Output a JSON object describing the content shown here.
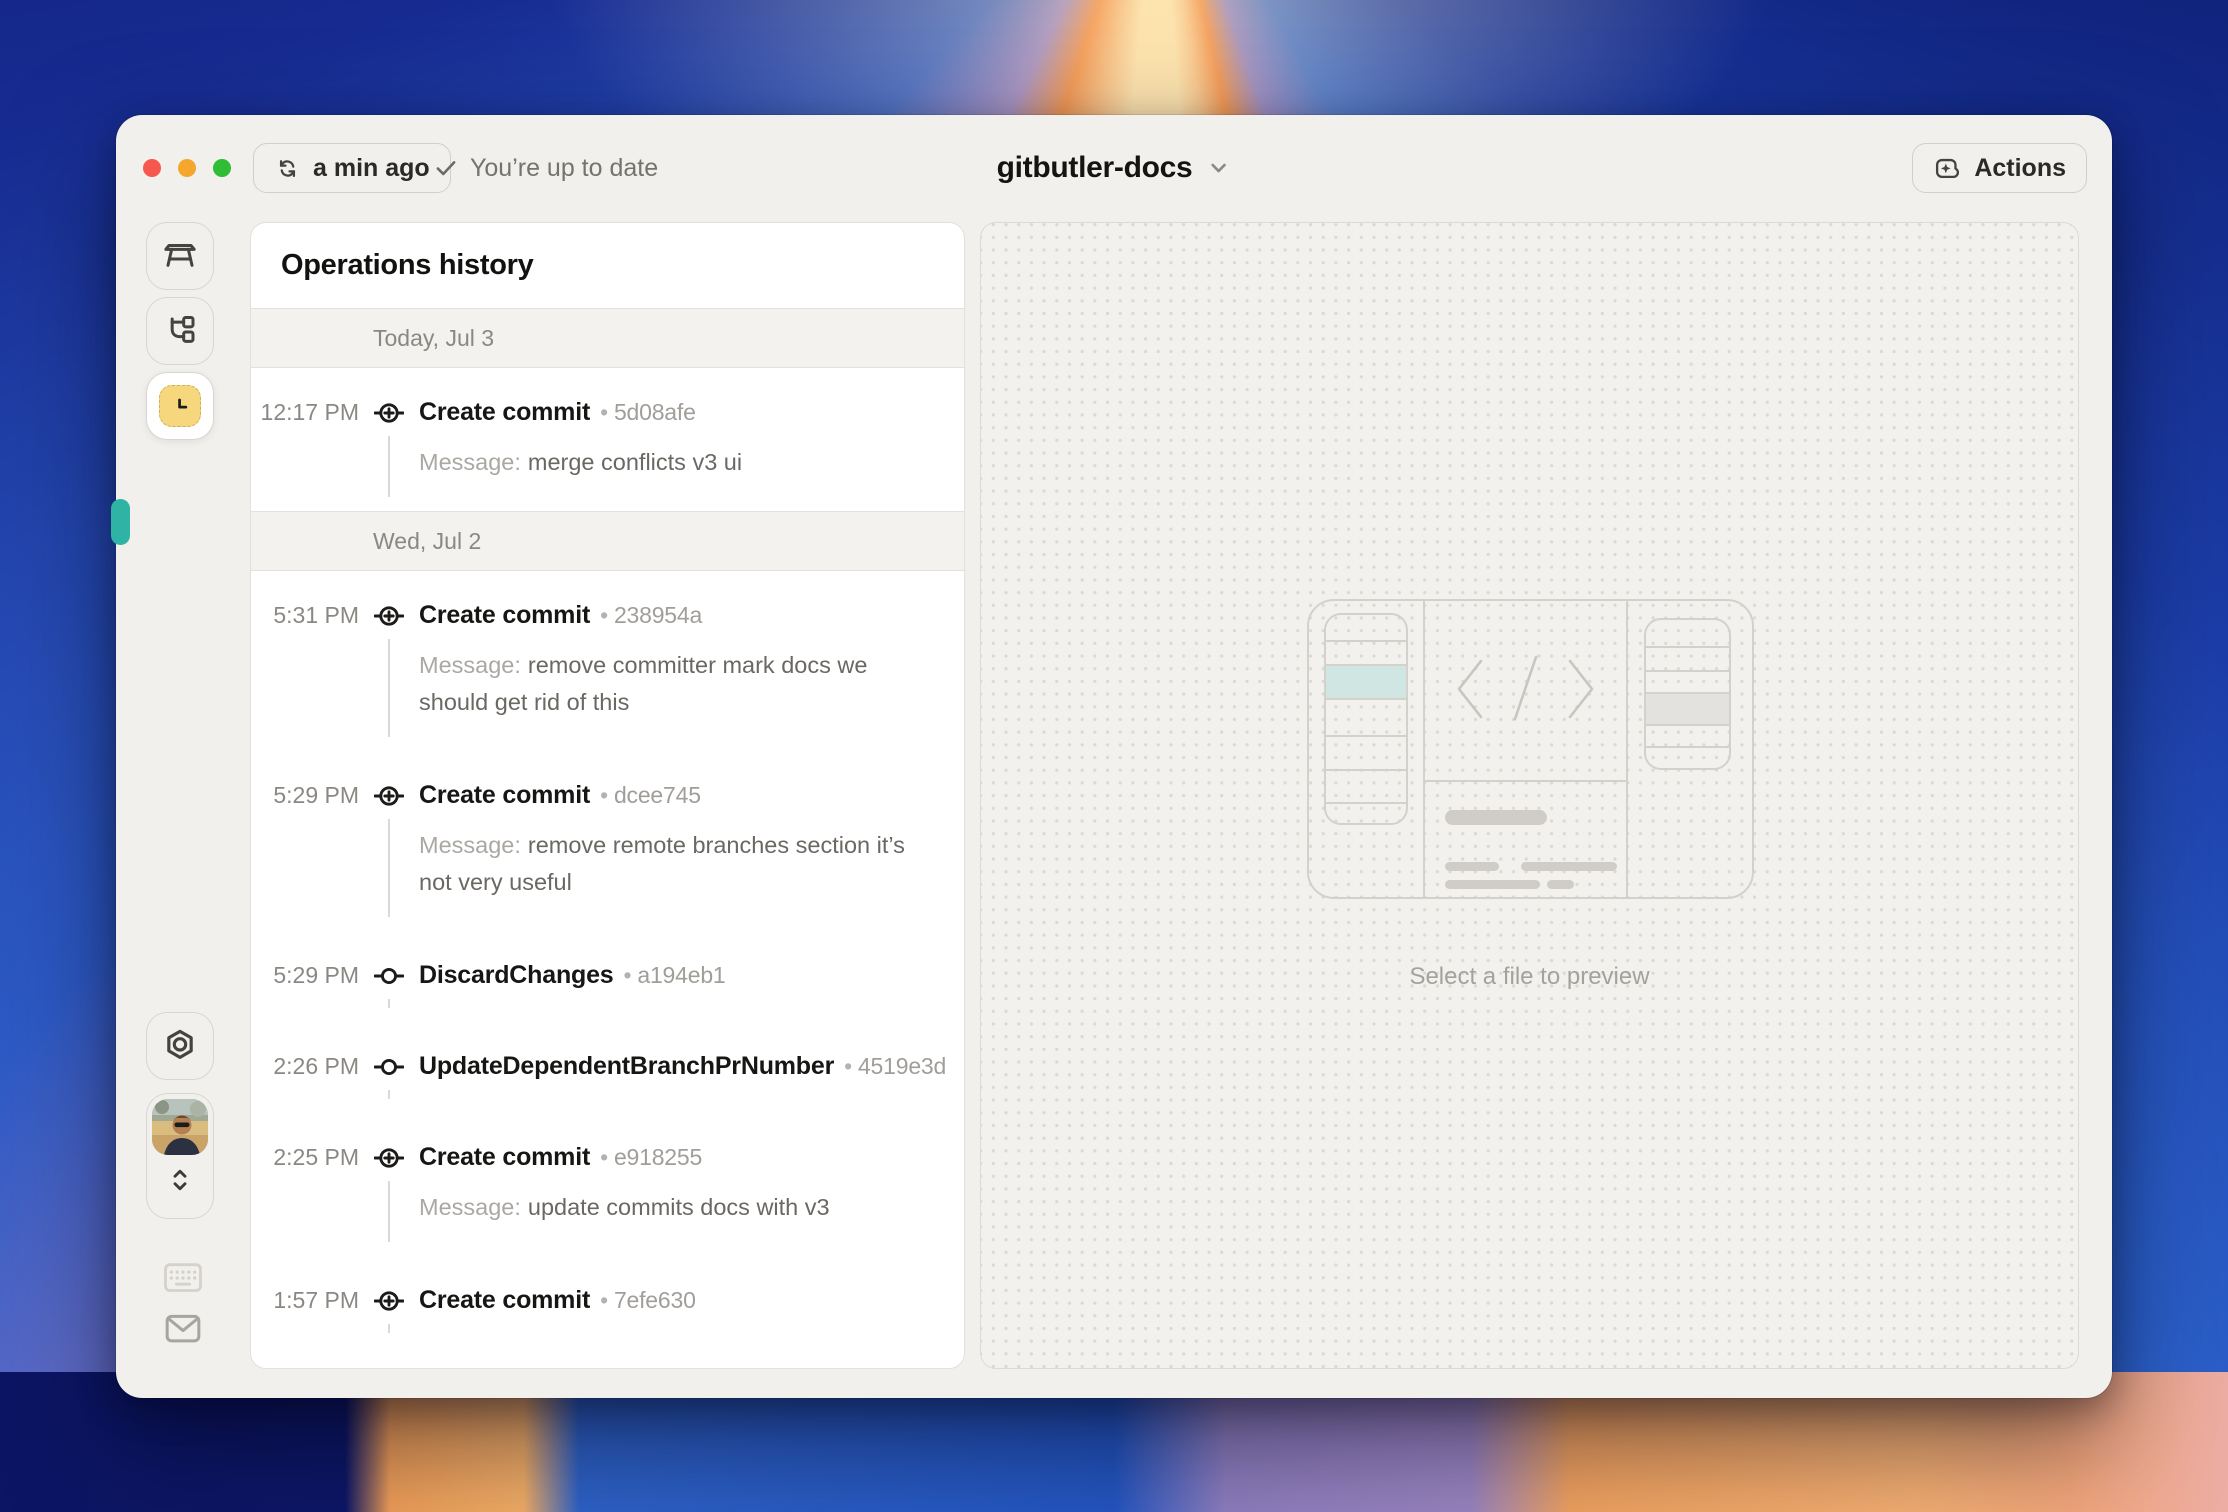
{
  "titlebar": {
    "last_sync": "a min ago",
    "sync_status": "You’re up to date",
    "project_name": "gitbutler-docs",
    "actions_label": "Actions"
  },
  "sidebar": {
    "items": [
      {
        "id": "workspace",
        "icon": "workbench-icon",
        "active": false
      },
      {
        "id": "branches",
        "icon": "branches-icon",
        "active": false
      },
      {
        "id": "history",
        "icon": "history-clock-icon",
        "active": true
      }
    ],
    "bottom_items": [
      {
        "id": "settings",
        "icon": "settings-icon"
      },
      {
        "id": "profile",
        "icon": "avatar"
      },
      {
        "id": "keyboard",
        "icon": "keyboard-icon"
      },
      {
        "id": "feedback",
        "icon": "mail-icon"
      }
    ]
  },
  "history": {
    "title": "Operations history",
    "bullet": "•",
    "message_label": "Message:",
    "groups": [
      {
        "date": "Today, Jul 3",
        "entries": [
          {
            "time": "12:17 PM",
            "icon": "commit-plus",
            "title": "Create commit",
            "hash": "5d08afe",
            "message": "merge conflicts v3 ui"
          }
        ]
      },
      {
        "date": "Wed, Jul 2",
        "entries": [
          {
            "time": "5:31 PM",
            "icon": "commit-plus",
            "title": "Create commit",
            "hash": "238954a",
            "message": "remove committer mark docs we should get rid of this"
          },
          {
            "time": "5:29 PM",
            "icon": "commit-plus",
            "title": "Create commit",
            "hash": "dcee745",
            "message": "remove remote branches section it’s not very useful"
          },
          {
            "time": "5:29 PM",
            "icon": "commit",
            "title": "DiscardChanges",
            "hash": "a194eb1"
          },
          {
            "time": "2:26 PM",
            "icon": "commit",
            "title": "UpdateDependentBranchPrNumber",
            "hash": "4519e3d"
          },
          {
            "time": "2:25 PM",
            "icon": "commit-plus",
            "title": "Create commit",
            "hash": "e918255",
            "message": "update commits docs with v3"
          },
          {
            "time": "1:57 PM",
            "icon": "commit-plus",
            "title": "Create commit",
            "hash": "7efe630"
          }
        ]
      }
    ]
  },
  "preview": {
    "placeholder": "Select a file to preview"
  },
  "colors": {
    "accent_teal": "#2eb3a4",
    "history_tab_yellow": "#f6d77e",
    "traffic_red": "#f6584e",
    "traffic_yellow": "#f4a72c",
    "traffic_green": "#2ebd35"
  }
}
